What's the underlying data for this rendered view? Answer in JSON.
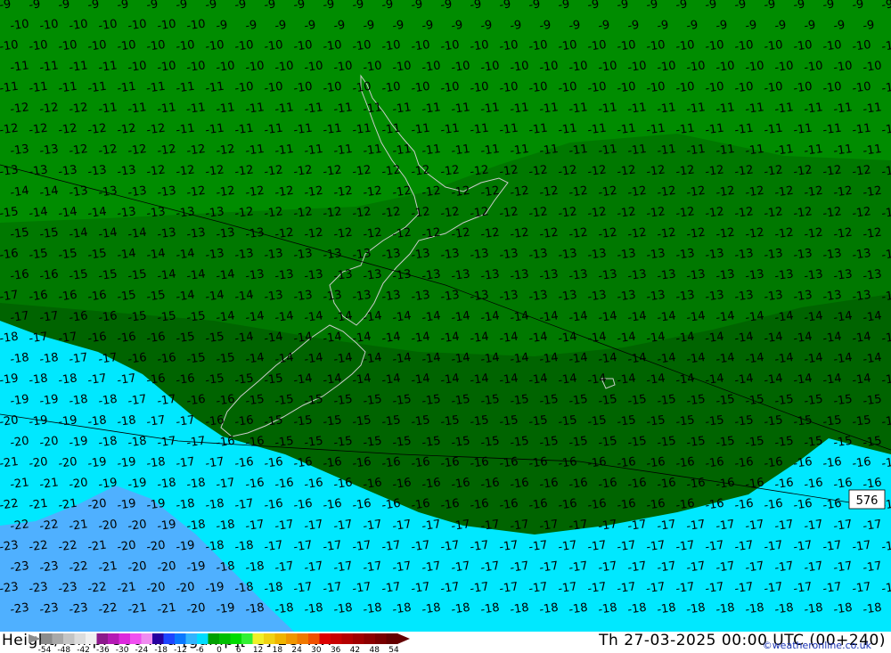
{
  "map": {
    "temperature_labels": [
      "-9",
      "-10",
      "-11",
      "-12",
      "-13",
      "-14",
      "-15",
      "-16",
      "-17",
      "-18",
      "-19",
      "-20",
      "-21",
      "-22",
      "-23"
    ],
    "contour_label": "576",
    "colors": {
      "band_m9_to_m12": "#008c00",
      "band_m12_to_m15": "#007800",
      "band_m15_to_m18": "#006400",
      "band_m18_to_m24": "#00e8ff",
      "band_m24_plus": "#4fb0ff",
      "coastline": "#cccccc",
      "contour": "#000000"
    }
  },
  "footer": {
    "title_left": "Height/Temp. 500 hPa [gdmp][°C] ECMWF",
    "title_right": "Th 27-03-2025 00:00 UTC (00+240)",
    "credit": "©weatheronline.co.uk",
    "colorbar_ticks": [
      "-54",
      "-48",
      "-42",
      "-36",
      "-30",
      "-24",
      "-18",
      "-12",
      "-6",
      "0",
      "6",
      "12",
      "18",
      "24",
      "30",
      "36",
      "42",
      "48",
      "54"
    ],
    "colorbar_colors": [
      "#8c8c8c",
      "#a8a8a8",
      "#c4c4c4",
      "#dcdcdc",
      "#f0f0f0",
      "#8c1a8c",
      "#b41ab4",
      "#dc28dc",
      "#f050f0",
      "#f08cf0",
      "#2800a0",
      "#1e46ff",
      "#0a78ff",
      "#32b4ff",
      "#00dcff",
      "#00a000",
      "#00be00",
      "#00dc00",
      "#32f032",
      "#f0f028",
      "#f0d214",
      "#f0b400",
      "#f09600",
      "#f07800",
      "#f05000",
      "#dc0000",
      "#c80000",
      "#b40000",
      "#a00000",
      "#8c0000",
      "#780000",
      "#640000"
    ]
  }
}
